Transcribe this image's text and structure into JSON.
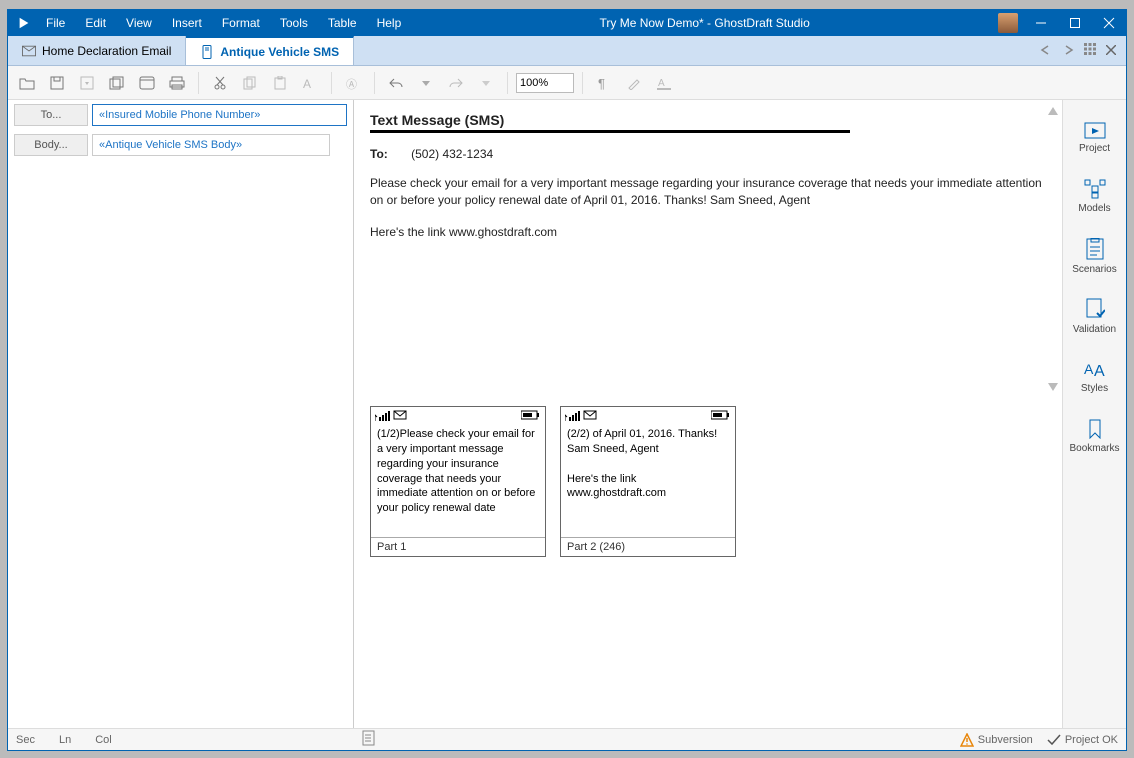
{
  "window": {
    "title": "Try Me Now Demo* - GhostDraft Studio"
  },
  "menus": {
    "file": "File",
    "edit": "Edit",
    "view": "View",
    "insert": "Insert",
    "format": "Format",
    "tools": "Tools",
    "table": "Table",
    "help": "Help"
  },
  "tabs": {
    "home": "Home Declaration Email",
    "antique": "Antique Vehicle SMS"
  },
  "toolbar": {
    "zoom": "100%"
  },
  "fields": {
    "to_label": "To...",
    "to_value": "«Insured Mobile Phone Number»",
    "body_label": "Body...",
    "body_value": "«Antique Vehicle SMS Body»"
  },
  "sms": {
    "heading": "Text Message (SMS)",
    "to_label": "To:",
    "to_value": "(502) 432-1234",
    "paragraph1": "Please check your email for a very important message regarding your insurance coverage that needs your immediate attention on or before your policy renewal date of April 01, 2016.  Thanks!  Sam Sneed, Agent",
    "paragraph2": "Here's the link www.ghostdraft.com"
  },
  "preview": {
    "part1_body": "(1/2)Please check your email for a very important message regarding your insurance coverage that needs your immediate attention on or before your policy renewal date",
    "part1_label": "Part 1",
    "part2_body1": "(2/2) of April 01, 2016.  Thanks!  Sam Sneed, Agent",
    "part2_body2": "Here's the link www.ghostdraft.com",
    "part2_label": "Part 2 (246)"
  },
  "sidebar": {
    "project": "Project",
    "models": "Models",
    "scenarios": "Scenarios",
    "validation": "Validation",
    "styles": "Styles",
    "bookmarks": "Bookmarks"
  },
  "status": {
    "sec": "Sec",
    "ln": "Ln",
    "col": "Col",
    "subversion": "Subversion",
    "project_ok": "Project OK"
  }
}
